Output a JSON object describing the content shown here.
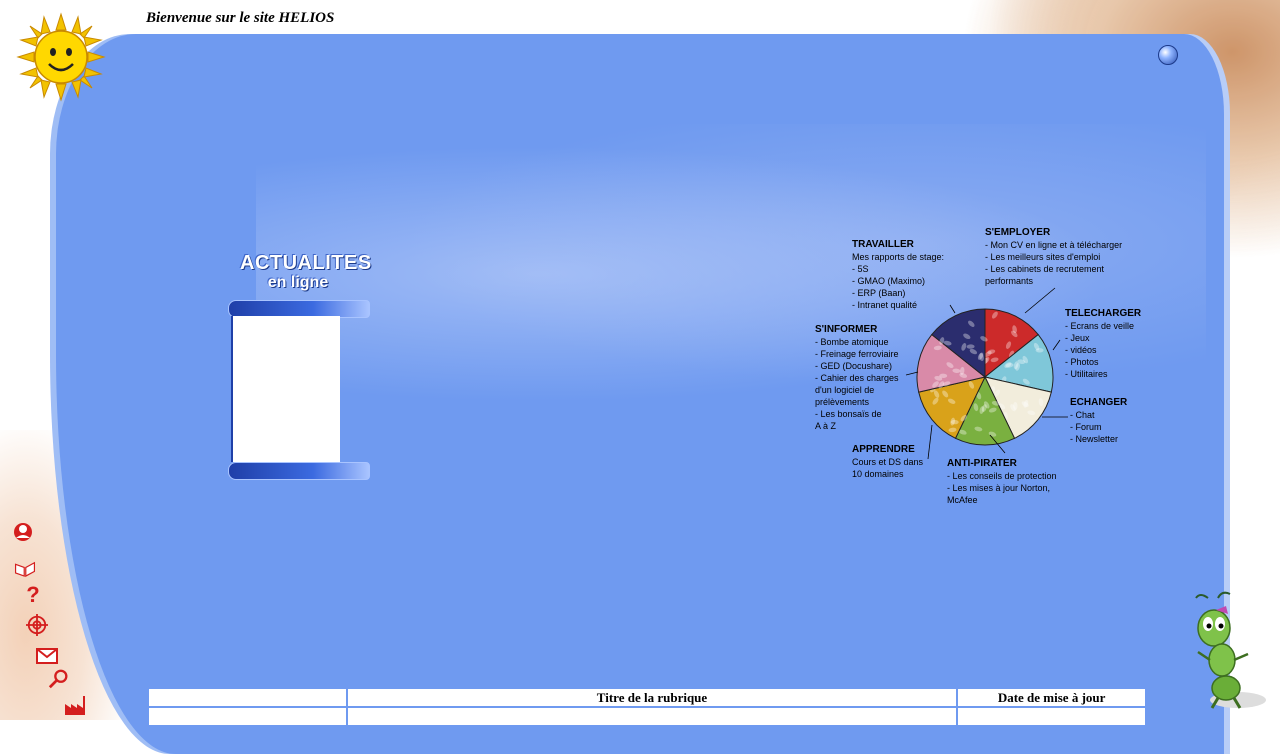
{
  "header": {
    "title": "Bienvenue sur le site HELIOS"
  },
  "news": {
    "title_line1": "ACTUALITES",
    "title_line2": "en ligne"
  },
  "pie_labels": {
    "travailler": {
      "heading": "TRAVAILLER",
      "lines": [
        "Mes rapports de stage:",
        "- 5S",
        "- GMAO (Maximo)",
        "- ERP (Baan)",
        "- Intranet qualité"
      ]
    },
    "semployer": {
      "heading": "S'EMPLOYER",
      "lines": [
        "- Mon CV en ligne et à télécharger",
        "- Les meilleurs sites d'emploi",
        "- Les cabinets de recrutement",
        "performants"
      ]
    },
    "telecharger": {
      "heading": "TELECHARGER",
      "lines": [
        "- Ecrans de veille",
        "- Jeux",
        "- vidéos",
        "- Photos",
        "- Utilitaires"
      ]
    },
    "sinformer": {
      "heading": "S'INFORMER",
      "lines": [
        "- Bombe atomique",
        "- Freinage ferroviaire",
        "- GED (Docushare)",
        "- Cahier des charges",
        "d'un logiciel de",
        "prélèvements",
        "- Les bonsaïs de",
        "A à Z"
      ]
    },
    "echanger": {
      "heading": "ECHANGER",
      "lines": [
        "- Chat",
        "- Forum",
        "- Newsletter"
      ]
    },
    "apprendre": {
      "heading": "APPRENDRE",
      "lines": [
        "Cours et DS dans",
        "10 domaines"
      ]
    },
    "antipirater": {
      "heading": "ANTI-PIRATER",
      "lines": [
        "- Les conseils de protection",
        "- Les mises à jour Norton,",
        "McAfee"
      ]
    }
  },
  "pie_slice_colors": [
    "#cc2a2a",
    "#7fc7d9",
    "#f2eddc",
    "#7ab040",
    "#d9a21a",
    "#d98aa8",
    "#2b2d6e"
  ],
  "left_icons": [
    "profile-icon",
    "book-icon",
    "question-icon",
    "target-icon",
    "mail-icon",
    "search-icon",
    "factory-icon"
  ],
  "table": {
    "headers": [
      "",
      "Titre de la rubrique",
      "Date de mise à jour"
    ]
  }
}
